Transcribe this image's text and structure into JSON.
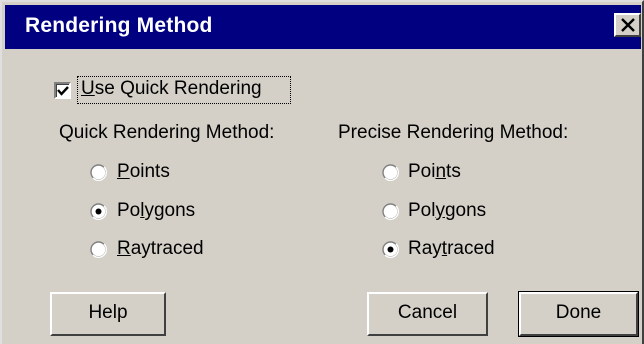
{
  "window": {
    "title": "Rendering Method",
    "close_icon": "close-icon"
  },
  "use_quick_rendering": {
    "label": "Use Quick Rendering",
    "checked": true
  },
  "quick_group": {
    "heading": "Quick Rendering Method:",
    "options": [
      {
        "label": "Points",
        "selected": false
      },
      {
        "label": "Polygons",
        "selected": true
      },
      {
        "label": "Raytraced",
        "selected": false
      }
    ]
  },
  "precise_group": {
    "heading": "Precise Rendering Method:",
    "options": [
      {
        "label": "Points",
        "selected": false
      },
      {
        "label": "Polygons",
        "selected": false
      },
      {
        "label": "Raytraced",
        "selected": true
      }
    ]
  },
  "buttons": {
    "help": "Help",
    "cancel": "Cancel",
    "done": "Done"
  },
  "colors": {
    "titlebar": "#000080",
    "face": "#d4d0c8",
    "title_text": "#ffffff"
  }
}
